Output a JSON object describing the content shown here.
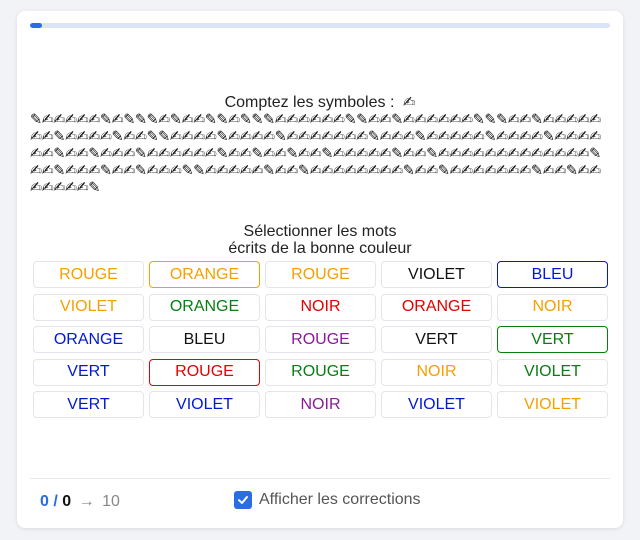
{
  "progress": {
    "fraction": 0.02
  },
  "count": {
    "prompt": "Comptez les symboles :",
    "target_symbol": "✍",
    "symbols_text": "✎✍✍✍✍✍✎✍✎✎✎✍✎✍✍✎✎✍✎✎✎✍✍✍✍✍✍✎✎✍✍✎✍✍✍✍✍✍✎✎✎✍✍✎✍✍✍✍✍✍✍✎✍✍✍✍✎✍✍✎✎✍✍✍✍✎✍✍✍✍✎✍✍✍✍✍✍✍✎✍✍✍✎✍✍✍✍✍✎✍✍✍✍✎✍✍✍✍✍✍✎✍✍✎✍✍✍✎✍✍✍✍✍✍✎✍✍✎✍✍✎✍✍✎✍✍✍✍✍✎✍✍✎✍✍✍✍✍✍✍✍✍✍✍✍✍✎✍✍✎✍✍✍✎✍✍✎✍✍✍✎✎✍✍✍✍✍✎✍✍✎✍✍✍✍✍✍✍✍✎✍✍✎✍✍✍✍✍✍✍✎✍✍✎✍✍✍✍✍✍✍✎"
  },
  "words": {
    "instruction_line1": "Sélectionner les mots",
    "instruction_line2": "écrits de la bonne couleur",
    "items": [
      {
        "text": "ROUGE",
        "color": "#f5a000",
        "selected": false
      },
      {
        "text": "ORANGE",
        "color": "#f5a000",
        "selected": true,
        "border": "#f5a000"
      },
      {
        "text": "ROUGE",
        "color": "#f5a000",
        "selected": false
      },
      {
        "text": "VIOLET",
        "color": "#111111",
        "selected": false
      },
      {
        "text": "BLEU",
        "color": "#0019d6",
        "selected": true,
        "border": "#0019d6"
      },
      {
        "text": "VIOLET",
        "color": "#f5a000",
        "selected": false
      },
      {
        "text": "ORANGE",
        "color": "#0a7d12",
        "selected": false
      },
      {
        "text": "NOIR",
        "color": "#e60000",
        "selected": false
      },
      {
        "text": "ORANGE",
        "color": "#e60000",
        "selected": false
      },
      {
        "text": "NOIR",
        "color": "#f5a000",
        "selected": false
      },
      {
        "text": "ORANGE",
        "color": "#0019d6",
        "selected": false
      },
      {
        "text": "BLEU",
        "color": "#111111",
        "selected": false
      },
      {
        "text": "ROUGE",
        "color": "#8a1a99",
        "selected": false
      },
      {
        "text": "VERT",
        "color": "#111111",
        "selected": false
      },
      {
        "text": "VERT",
        "color": "#0a7d12",
        "selected": true,
        "border": "#0a7d12"
      },
      {
        "text": "VERT",
        "color": "#0019d6",
        "selected": false
      },
      {
        "text": "ROUGE",
        "color": "#e60000",
        "selected": true,
        "border": "#e60000"
      },
      {
        "text": "ROUGE",
        "color": "#0a7d12",
        "selected": false
      },
      {
        "text": "NOIR",
        "color": "#f5a000",
        "selected": false
      },
      {
        "text": "VIOLET",
        "color": "#0a7d12",
        "selected": false
      },
      {
        "text": "VERT",
        "color": "#0019d6",
        "selected": false
      },
      {
        "text": "VIOLET",
        "color": "#0019d6",
        "selected": false
      },
      {
        "text": "NOIR",
        "color": "#8a1a99",
        "selected": false
      },
      {
        "text": "VIOLET",
        "color": "#0019d6",
        "selected": false
      },
      {
        "text": "VIOLET",
        "color": "#f5a000",
        "selected": false
      }
    ]
  },
  "score": {
    "correct": "0",
    "separator": "/",
    "wrong": "0",
    "arrow": "→",
    "goal": "10"
  },
  "corrections": {
    "label": "Afficher les corrections",
    "checked": true
  },
  "colors": {
    "accent": "#2a6de0"
  }
}
